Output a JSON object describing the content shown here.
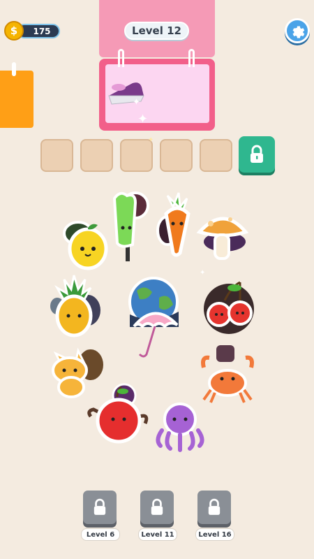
{
  "hud": {
    "coins": "175",
    "level_title": "Level 12"
  },
  "board": {
    "tool_icon": "iron-icon"
  },
  "slots": {
    "count": 5,
    "locked_extra": true
  },
  "stickers": [
    {
      "name": "lemon-sticker"
    },
    {
      "name": "popsicle-sticker"
    },
    {
      "name": "carrot-sticker"
    },
    {
      "name": "mushroom-sticker"
    },
    {
      "name": "pineapple-sticker"
    },
    {
      "name": "earth-sticker"
    },
    {
      "name": "umbrella-sticker"
    },
    {
      "name": "cherries-sticker"
    },
    {
      "name": "cat-sticker"
    },
    {
      "name": "crab-sticker"
    },
    {
      "name": "apple-sticker"
    },
    {
      "name": "octopus-sticker"
    }
  ],
  "level_buttons": [
    {
      "label": "Level 6"
    },
    {
      "label": "Level 11"
    },
    {
      "label": "Level 16"
    }
  ],
  "colors": {
    "background": "#f4ebe0",
    "board_pink": "#f25f8a",
    "unlock_green": "#2fb78f",
    "side_board": "#ff9f16"
  }
}
